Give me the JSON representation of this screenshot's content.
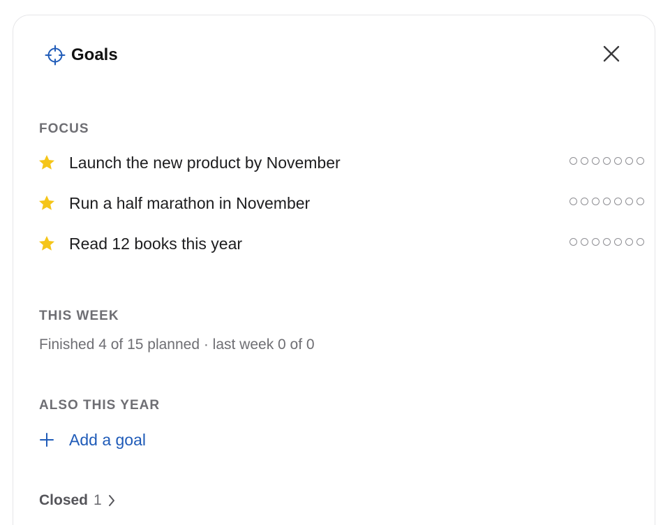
{
  "header": {
    "title": "Goals",
    "icon": "target-icon",
    "close_icon": "close-icon"
  },
  "focus": {
    "label": "FOCUS",
    "goals": [
      {
        "text": "Launch the new product by November",
        "progress_dots": 7
      },
      {
        "text": "Run a half marathon in November",
        "progress_dots": 7
      },
      {
        "text": "Read 12 books this year",
        "progress_dots": 7
      }
    ]
  },
  "this_week": {
    "label": "THIS WEEK",
    "summary": "Finished 4 of 15 planned · last week 0 of 0"
  },
  "also_this_year": {
    "label": "ALSO THIS YEAR",
    "add_label": "Add a goal"
  },
  "closed": {
    "label": "Closed",
    "count": "1"
  },
  "colors": {
    "accent": "#1f5bb8",
    "star": "#f5c518",
    "muted": "#6e6e73"
  }
}
